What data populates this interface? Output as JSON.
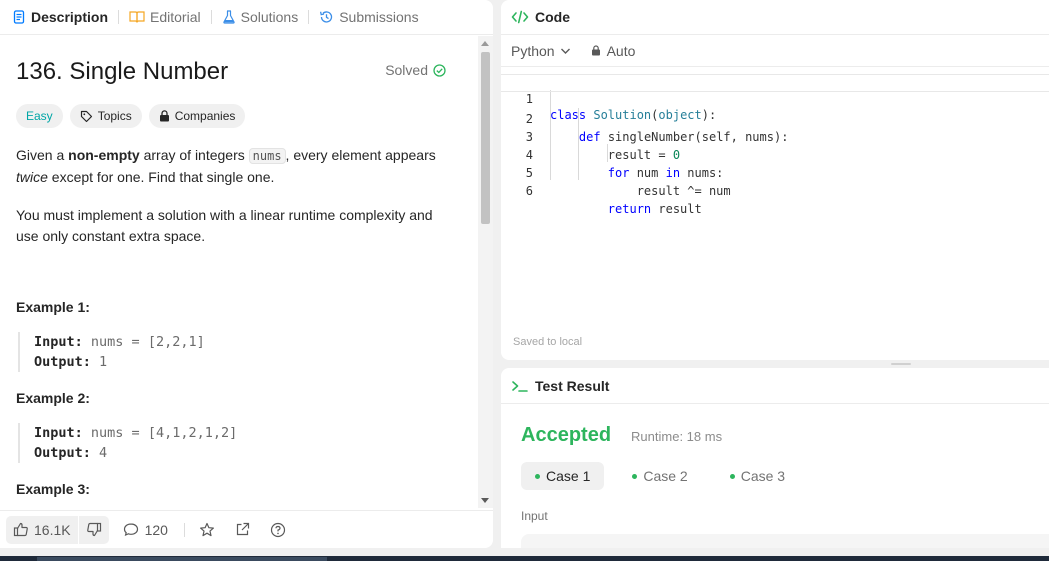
{
  "left_tabs": [
    {
      "label": "Description",
      "icon": "description-icon",
      "active": true
    },
    {
      "label": "Editorial",
      "icon": "editorial-icon",
      "active": false
    },
    {
      "label": "Solutions",
      "icon": "flask-icon",
      "active": false
    },
    {
      "label": "Submissions",
      "icon": "history-icon",
      "active": false
    }
  ],
  "problem": {
    "title": "136. Single Number",
    "solved_label": "Solved",
    "tags": {
      "difficulty": "Easy",
      "topics": "Topics",
      "companies": "Companies"
    },
    "para1": {
      "t1": "Given a ",
      "b1": "non-empty",
      "t2": " array of integers ",
      "code1": "nums",
      "t3": ", every element appears ",
      "i1": "twice",
      "t4": " except for one. Find that single one."
    },
    "para2": "You must implement a solution with a linear runtime complexity and use only constant extra space.",
    "examples": [
      {
        "title": "Example 1:",
        "input_label": "Input:",
        "input_value": "nums = [2,2,1]",
        "output_label": "Output:",
        "output_value": "1"
      },
      {
        "title": "Example 2:",
        "input_label": "Input:",
        "input_value": "nums = [4,1,2,1,2]",
        "output_label": "Output:",
        "output_value": "4"
      },
      {
        "title": "Example 3:"
      }
    ]
  },
  "bottom_bar": {
    "likes": "16.1K",
    "comments": "120"
  },
  "code_panel": {
    "title": "Code",
    "language": "Python",
    "mode": "Auto",
    "saved_status": "Saved to local",
    "line_numbers": [
      "1",
      "2",
      "3",
      "4",
      "5",
      "6"
    ]
  },
  "test_result": {
    "title": "Test Result",
    "status": "Accepted",
    "runtime": "Runtime: 18 ms",
    "cases": [
      "Case 1",
      "Case 2",
      "Case 3"
    ],
    "input_label": "Input"
  },
  "colors": {
    "accent_green": "#2db55d",
    "easy": "#00a6a6",
    "keyword": "#0000ff"
  }
}
